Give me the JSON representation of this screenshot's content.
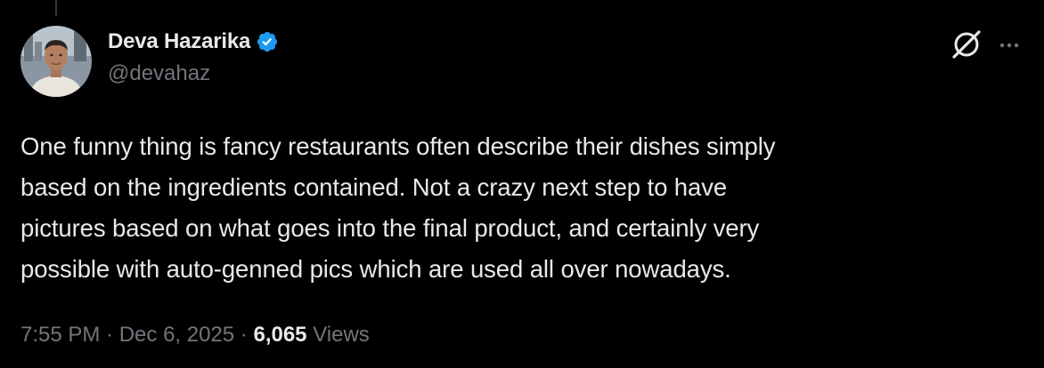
{
  "author": {
    "display_name": "Deva Hazarika",
    "handle": "@devahaz",
    "verified": true,
    "avatar": "avatar-photo"
  },
  "tweet": {
    "text_lines": [
      "One funny thing is fancy restaurants often describe their dishes simply",
      "based on the ingredients contained. Not a crazy next step to have",
      "pictures based on what goes into the final product, and certainly very",
      "possible with auto-genned pics which are used all over nowadays."
    ]
  },
  "meta": {
    "time": "7:55 PM",
    "separator": " · ",
    "date": "Dec 6, 2025",
    "views_count": "6,065",
    "views_label": "Views"
  },
  "icons": {
    "verified": "verified-badge-icon",
    "grok": "grok-icon",
    "more": "more-options-icon"
  },
  "colors": {
    "background": "#000000",
    "primary_text": "#e7e9ea",
    "secondary_text": "#71767b",
    "verified_blue": "#1d9bf0"
  }
}
